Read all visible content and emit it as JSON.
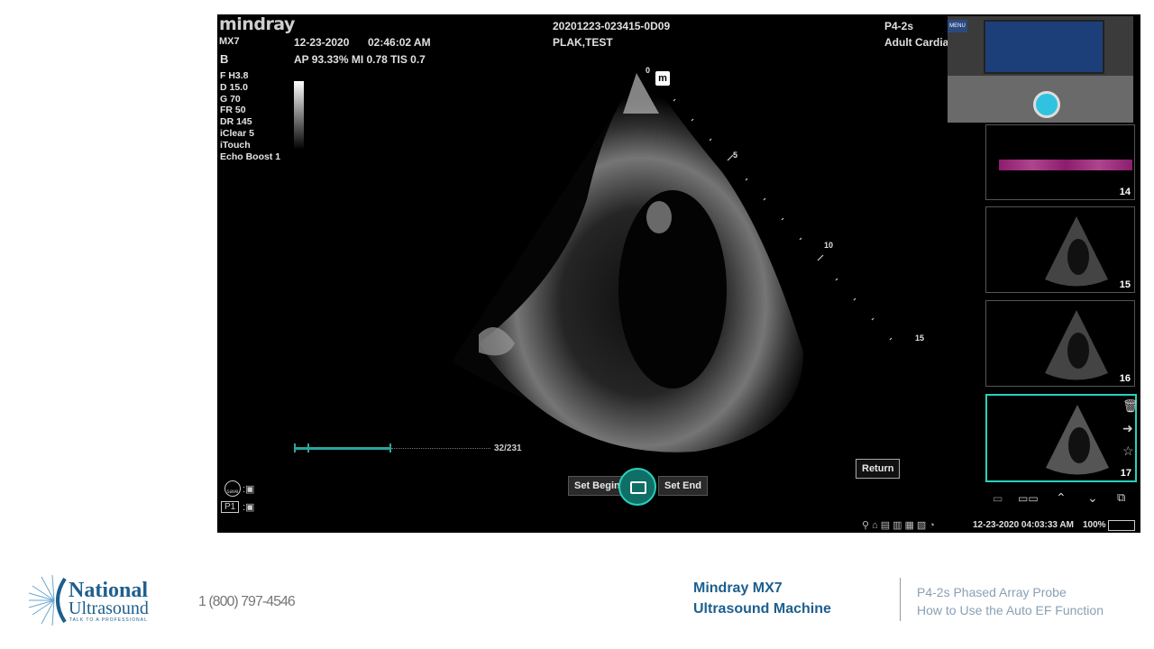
{
  "device": {
    "brand": "mindray",
    "model": "MX7",
    "date": "12-23-2020",
    "time": "02:46:02 AM",
    "patient_id": "20201223-023415-0D09",
    "patient_name": "PLAK,TEST",
    "probe": "P4-2s",
    "exam": "Adult Cardia",
    "mode": "B",
    "ap_line": "AP 93.33%  MI 0.78 TIS 0.7",
    "params": [
      "F H3.8",
      "D 15.0",
      "G 70",
      "FR 50",
      "DR 145",
      "iClear 5",
      "iTouch",
      "Echo Boost 1"
    ],
    "depth_marks": [
      "0",
      "5",
      "10",
      "15"
    ],
    "frame_counter": "32/231",
    "buttons": {
      "set_begin": "Set Begin",
      "set_end": "Set End",
      "return": "Return"
    },
    "status_bar": {
      "datetime": "12-23-2020 04:03:33 AM",
      "battery": "100%"
    },
    "menu_label": "MENU",
    "shortcut_p1": "P1",
    "shortcut_save": "save",
    "thumbnails": [
      {
        "number": "14",
        "type": "doppler"
      },
      {
        "number": "15",
        "type": "echo"
      },
      {
        "number": "16",
        "type": "echo"
      },
      {
        "number": "17",
        "type": "echo",
        "selected": true
      }
    ],
    "accent_color": "#2aa59d"
  },
  "footer": {
    "logo_line1": "National",
    "logo_line2": "Ultrasound",
    "logo_tagline": "TALK TO A PROFESSIONAL",
    "phone": "1 (800) 797-4546",
    "product_line1": "Mindray MX7",
    "product_line2": "Ultrasound Machine",
    "topic_line1": "P4-2s Phased Array Probe",
    "topic_line2": "How to Use the Auto EF Function"
  }
}
